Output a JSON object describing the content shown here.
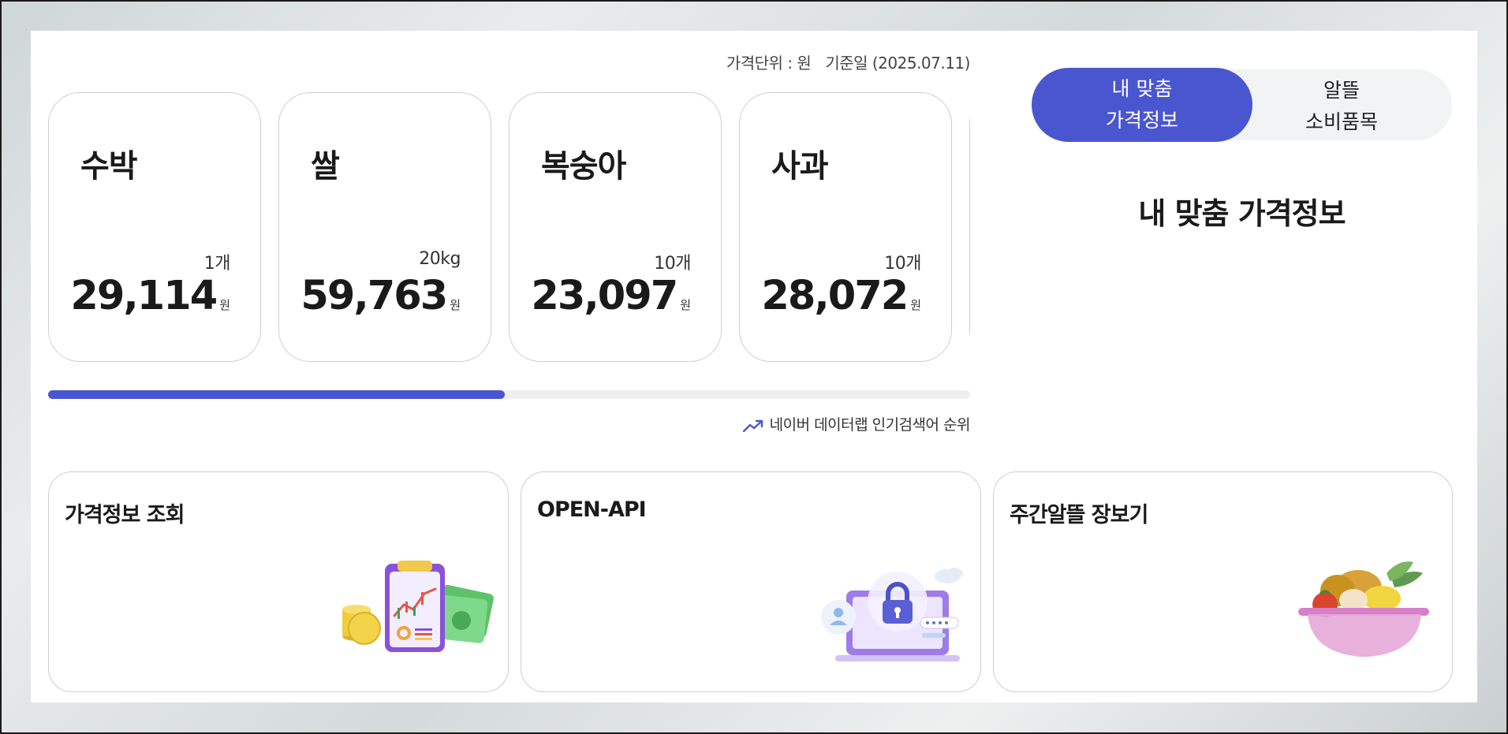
{
  "header": {
    "price_unit": "가격단위 : 원",
    "base_date": "기준일 (2025.07.11)"
  },
  "price_cards": [
    {
      "name": "수박",
      "unit": "1개",
      "price": "29,114",
      "currency": "원"
    },
    {
      "name": "쌀",
      "unit": "20kg",
      "price": "59,763",
      "currency": "원"
    },
    {
      "name": "복숭아",
      "unit": "10개",
      "price": "23,097",
      "currency": "원"
    },
    {
      "name": "사과",
      "unit": "10개",
      "price": "28,072",
      "currency": "원"
    }
  ],
  "carousel_progress": 0.495,
  "source_label": "네이버 데이터랩 인기검색어 순위",
  "tabs": [
    {
      "line1": "내 맞춤",
      "line2": "가격정보",
      "active": true
    },
    {
      "line1": "알뜰",
      "line2": "소비품목",
      "active": false
    }
  ],
  "right_panel_title": "내 맞춤 가격정보",
  "services": [
    {
      "title": "가격정보 조회",
      "icon": "price-chart-clipboard-icon"
    },
    {
      "title": "OPEN-API",
      "icon": "secure-laptop-icon"
    },
    {
      "title": "주간알뜰 장보기",
      "icon": "grocery-bowl-icon"
    }
  ],
  "colors": {
    "accent": "#4a56d0",
    "track": "#efefef",
    "card_border": "#cfcfcf"
  }
}
